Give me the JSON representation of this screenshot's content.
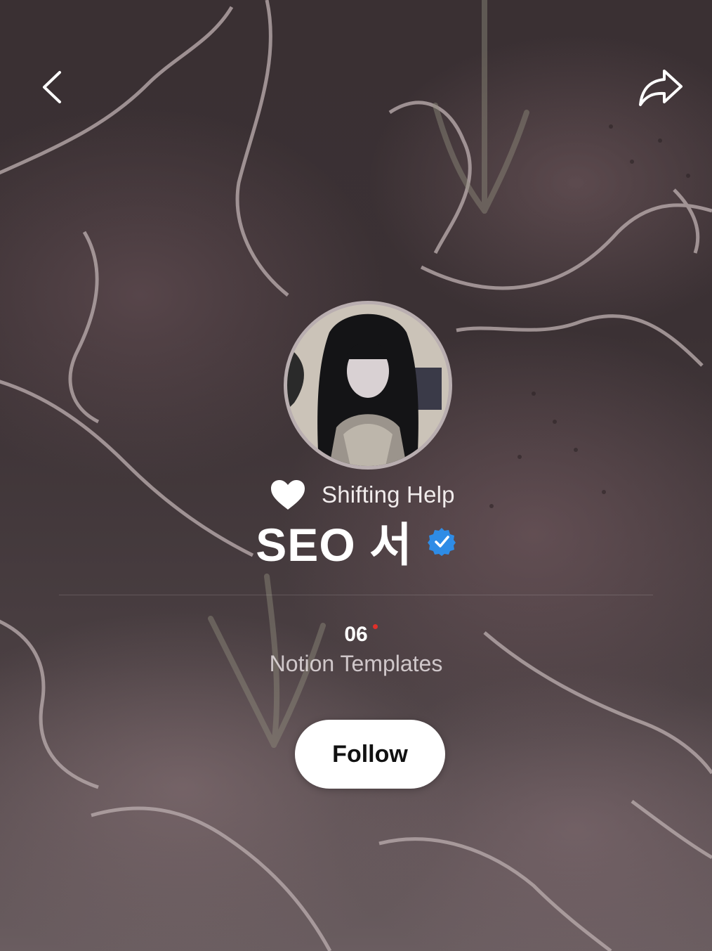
{
  "profile": {
    "tagline": "Shifting Help",
    "display_name": "SEO 서",
    "verified": true
  },
  "stats": {
    "count": "06",
    "label": "Notion Templates"
  },
  "actions": {
    "follow_label": "Follow"
  },
  "icons": {
    "back": "chevron-left-icon",
    "share": "share-arrow-icon",
    "tagline": "heart-icon",
    "verified": "verified-badge-icon"
  },
  "colors": {
    "accent_verified": "#2e8ce6",
    "new_indicator": "#e0302a",
    "button_bg": "#ffffff"
  }
}
